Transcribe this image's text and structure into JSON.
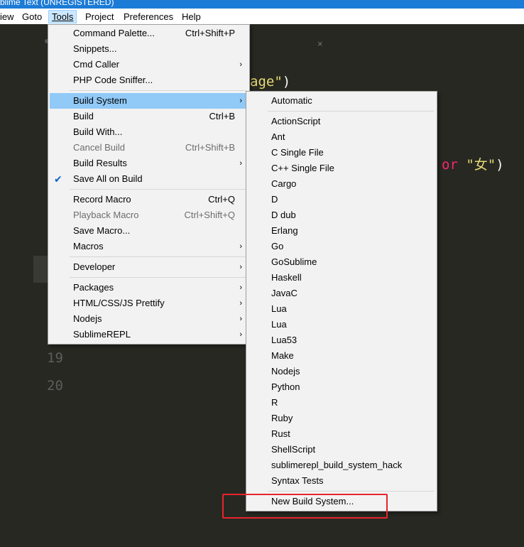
{
  "window": {
    "title": "blime Text (UNREGISTERED)"
  },
  "menubar": [
    {
      "label": "iew"
    },
    {
      "label": "Goto"
    },
    {
      "label": "Tools",
      "active": true
    },
    {
      "label": "Project"
    },
    {
      "label": "Preferences"
    },
    {
      "label": "Help"
    }
  ],
  "editor": {
    "tab_close": "×",
    "code_line1": {
      "string": "age\"",
      "paren": ")"
    },
    "code_line2": {
      "keyword": "or",
      "string": "\"女\"",
      "paren": ")"
    },
    "line_numbers": [
      "19",
      "20"
    ]
  },
  "tools_menu": {
    "items": [
      {
        "label": "Command Palette...",
        "accel": "Ctrl+Shift+P"
      },
      {
        "label": "Snippets..."
      },
      {
        "label": "Cmd Caller",
        "submenu": true
      },
      {
        "label": "PHP Code Sniffer..."
      },
      {
        "label": "Build System",
        "submenu": true,
        "highlighted": true
      },
      {
        "label": "Build",
        "accel": "Ctrl+B"
      },
      {
        "label": "Build With..."
      },
      {
        "label": "Cancel Build",
        "accel": "Ctrl+Shift+B",
        "disabled": true
      },
      {
        "label": "Build Results",
        "submenu": true
      },
      {
        "label": "Save All on Build",
        "checked": true
      },
      {
        "label": "Record Macro",
        "accel": "Ctrl+Q"
      },
      {
        "label": "Playback Macro",
        "accel": "Ctrl+Shift+Q",
        "disabled": true
      },
      {
        "label": "Save Macro..."
      },
      {
        "label": "Macros",
        "submenu": true
      },
      {
        "label": "Developer",
        "submenu": true
      },
      {
        "label": "Packages",
        "submenu": true
      },
      {
        "label": "HTML/CSS/JS Prettify",
        "submenu": true
      },
      {
        "label": "Nodejs",
        "submenu": true
      },
      {
        "label": "SublimeREPL",
        "submenu": true
      }
    ]
  },
  "build_system_menu": {
    "items": [
      {
        "label": "Automatic"
      },
      {
        "label": "ActionScript"
      },
      {
        "label": "Ant"
      },
      {
        "label": "C Single File"
      },
      {
        "label": "C++ Single File"
      },
      {
        "label": "Cargo"
      },
      {
        "label": "D"
      },
      {
        "label": "D dub"
      },
      {
        "label": "Erlang"
      },
      {
        "label": "Go"
      },
      {
        "label": "GoSublime"
      },
      {
        "label": "Haskell"
      },
      {
        "label": "JavaC"
      },
      {
        "label": "Lua"
      },
      {
        "label": "Lua"
      },
      {
        "label": "Lua53"
      },
      {
        "label": "Make"
      },
      {
        "label": "Nodejs"
      },
      {
        "label": "Python"
      },
      {
        "label": "R"
      },
      {
        "label": "Ruby"
      },
      {
        "label": "Rust"
      },
      {
        "label": "ShellScript"
      },
      {
        "label": "sublimerepl_build_system_hack"
      },
      {
        "label": "Syntax Tests"
      },
      {
        "label": "New Build System..."
      }
    ]
  },
  "icons": {
    "submenu_arrow": "›",
    "check": "✔"
  },
  "colors": {
    "highlight": "#91c9f7",
    "annotation_box": "#e8242b",
    "editor_bg": "#272822"
  }
}
